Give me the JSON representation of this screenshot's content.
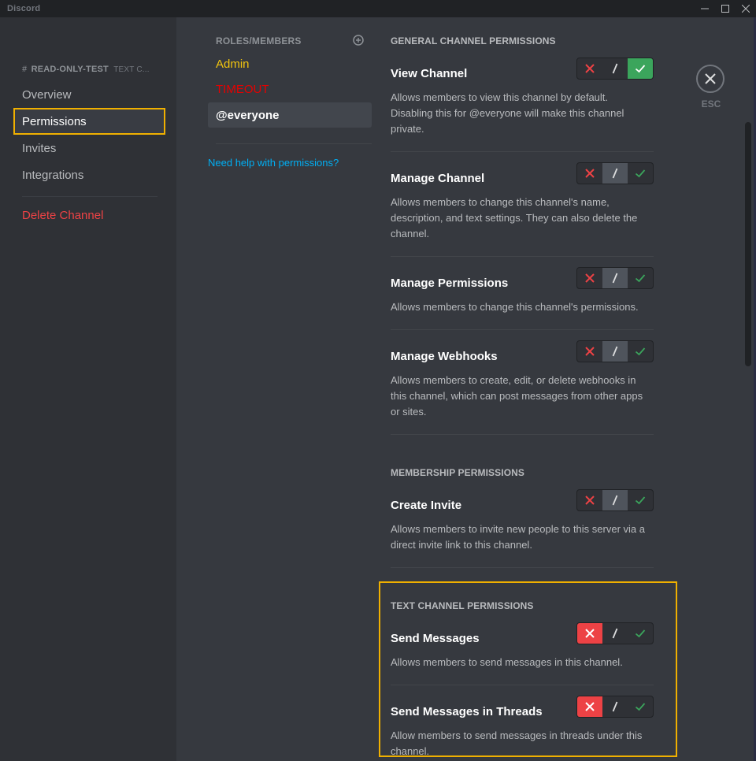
{
  "window": {
    "title": "Discord",
    "controls": [
      "minimize",
      "maximize",
      "close"
    ]
  },
  "sidebar": {
    "channel_hash": "#",
    "channel_name": "READ-ONLY-TEST",
    "channel_type": "TEXT C...",
    "items": [
      {
        "label": "Overview",
        "selected": false
      },
      {
        "label": "Permissions",
        "selected": true
      },
      {
        "label": "Invites",
        "selected": false
      },
      {
        "label": "Integrations",
        "selected": false
      }
    ],
    "danger_item": "Delete Channel"
  },
  "roles": {
    "header": "ROLES/MEMBERS",
    "add_icon": "plus-circle-icon",
    "items": [
      {
        "label": "Admin",
        "color": "#f1c40f",
        "selected": false
      },
      {
        "label": "TIMEOUT",
        "color": "#e60000",
        "selected": false
      },
      {
        "label": "@everyone",
        "color": "#ffffff",
        "selected": true
      }
    ],
    "help_link": "Need help with permissions?"
  },
  "sections": [
    {
      "title": "GENERAL CHANNEL PERMISSIONS",
      "permissions": [
        {
          "name": "View Channel",
          "description": "Allows members to view this channel by default. Disabling this for @everyone will make this channel private.",
          "state": "allow"
        },
        {
          "name": "Manage Channel",
          "description": "Allows members to change this channel's name, description, and text settings. They can also delete the channel.",
          "state": "neutral"
        },
        {
          "name": "Manage Permissions",
          "description": "Allows members to change this channel's permissions.",
          "state": "neutral"
        },
        {
          "name": "Manage Webhooks",
          "description": "Allows members to create, edit, or delete webhooks in this channel, which can post messages from other apps or sites.",
          "state": "neutral"
        }
      ]
    },
    {
      "title": "MEMBERSHIP PERMISSIONS",
      "permissions": [
        {
          "name": "Create Invite",
          "description": "Allows members to invite new people to this server via a direct invite link to this channel.",
          "state": "neutral"
        }
      ]
    },
    {
      "title": "TEXT CHANNEL PERMISSIONS",
      "permissions": [
        {
          "name": "Send Messages",
          "description": "Allows members to send messages in this channel.",
          "state": "deny"
        },
        {
          "name": "Send Messages in Threads",
          "description": "Allow members to send messages in threads under this channel.",
          "state": "deny"
        }
      ]
    }
  ],
  "toggle_icons": {
    "deny": "x-icon",
    "neutral": "slash-icon",
    "allow": "check-icon"
  },
  "close": {
    "label": "ESC"
  },
  "colors": {
    "deny": "#ed4245",
    "allow": "#3ba55c",
    "neutral": "#4f545c",
    "highlight": "#f0b000",
    "link": "#00aff4"
  }
}
